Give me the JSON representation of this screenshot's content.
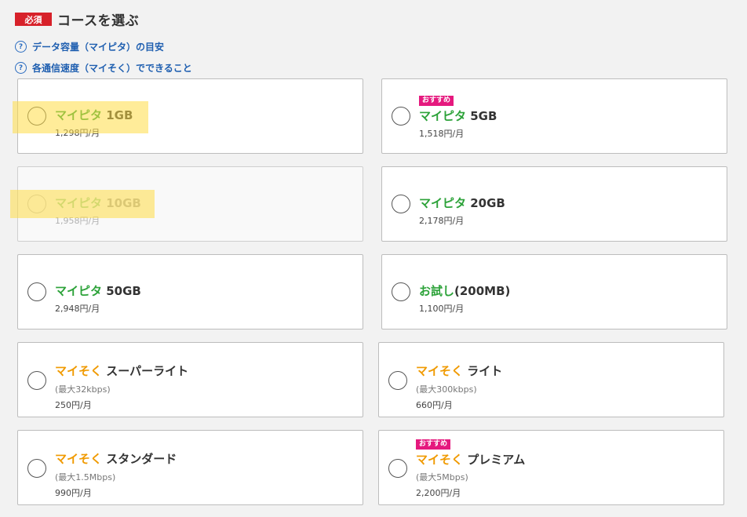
{
  "header": {
    "required_badge": "必須",
    "title": "コースを選ぶ"
  },
  "help_links": [
    {
      "label": "データ容量（マイピタ）の目安"
    },
    {
      "label": "各通信速度（マイそく）でできること"
    }
  ],
  "badge_recommended": "おすすめ",
  "courses": [
    {
      "brand": "マイピタ",
      "plan": "1GB",
      "price": "1,298円/月",
      "disabled": false
    },
    {
      "brand": "マイピタ",
      "plan": "5GB",
      "price": "1,518円/月",
      "recommended": true
    },
    {
      "brand": "マイピタ",
      "plan": "10GB",
      "price": "1,958円/月",
      "disabled": true
    },
    {
      "brand": "マイピタ",
      "plan": "20GB",
      "price": "2,178円/月"
    },
    {
      "brand": "マイピタ",
      "plan": "50GB",
      "price": "2,948円/月"
    },
    {
      "brand": "お試し",
      "plan": "(200MB)",
      "price": "1,100円/月"
    },
    {
      "brand": "マイそく",
      "plan": "スーパーライト",
      "speed": "(最大32kbps)",
      "price": "250円/月"
    },
    {
      "brand": "マイそく",
      "plan": "ライト",
      "speed": "(最大300kbps)",
      "price": "660円/月"
    },
    {
      "brand": "マイそく",
      "plan": "スタンダード",
      "speed": "(最大1.5Mbps)",
      "price": "990円/月"
    },
    {
      "brand": "マイそく",
      "plan": "プレミアム",
      "speed": "(最大5Mbps)",
      "price": "2,200円/月",
      "recommended": true
    }
  ],
  "colors": {
    "required_red": "#d7212a",
    "link_blue": "#1f5fb0",
    "brand_green": "#2ca239",
    "brand_orange": "#f09a00",
    "recommend_pink": "#e5197e",
    "highlight_yellow": "#ffdc46"
  }
}
